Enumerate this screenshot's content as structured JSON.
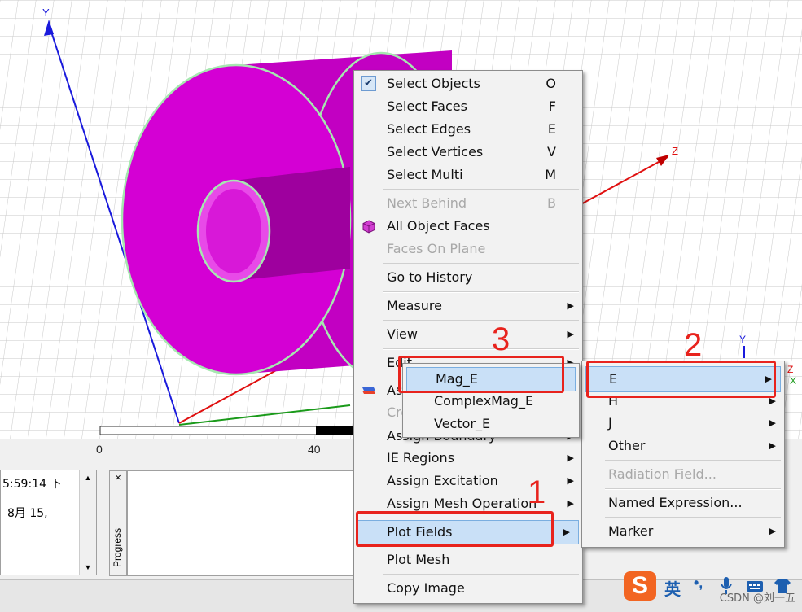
{
  "viewport": {
    "axes": {
      "y_label": "Y",
      "z_label": "Z",
      "small_y": "Y",
      "small_z": "Z",
      "small_x": "X"
    },
    "object_color": "#d400d4",
    "scale_ticks": [
      "0",
      "40"
    ]
  },
  "log_panel": {
    "time": "5:59:14 下",
    "date": "8月 15,"
  },
  "progress_panel": {
    "label": "Progress",
    "close": "×"
  },
  "context_menu": {
    "items": [
      {
        "label": "Select Objects",
        "key": "O"
      },
      {
        "label": "Select Faces",
        "key": "F"
      },
      {
        "label": "Select Edges",
        "key": "E"
      },
      {
        "label": "Select Vertices",
        "key": "V"
      },
      {
        "label": "Select Multi",
        "key": "M"
      },
      {
        "label": "Next Behind",
        "key": "B"
      },
      {
        "label": "All Object Faces"
      },
      {
        "label": "Faces On Plane"
      },
      {
        "label": "Go to History"
      },
      {
        "label": "Measure"
      },
      {
        "label": "View"
      },
      {
        "label": "Edit"
      },
      {
        "label": "As"
      },
      {
        "label": "Cre"
      },
      {
        "label": "Assign Boundary"
      },
      {
        "label": "IE Regions"
      },
      {
        "label": "Assign Excitation"
      },
      {
        "label": "Assign Mesh Operation"
      },
      {
        "label": "Plot Fields"
      },
      {
        "label": "Plot Mesh"
      },
      {
        "label": "Copy Image"
      }
    ]
  },
  "fields_submenu": {
    "items": [
      {
        "label": "E"
      },
      {
        "label": "H"
      },
      {
        "label": "J"
      },
      {
        "label": "Other"
      },
      {
        "label": "Radiation Field..."
      },
      {
        "label": "Named Expression..."
      },
      {
        "label": "Marker"
      }
    ]
  },
  "e_submenu": {
    "items": [
      {
        "label": "Mag_E"
      },
      {
        "label": "ComplexMag_E"
      },
      {
        "label": "Vector_E"
      }
    ]
  },
  "annotations": {
    "step1": "1",
    "step2": "2",
    "step3": "3",
    "colors": {
      "red": "#e8231d"
    }
  },
  "ime_toolbar": {
    "logo": "S",
    "lang": "英",
    "punct": "•,"
  },
  "watermark": "CSDN @刘一五"
}
